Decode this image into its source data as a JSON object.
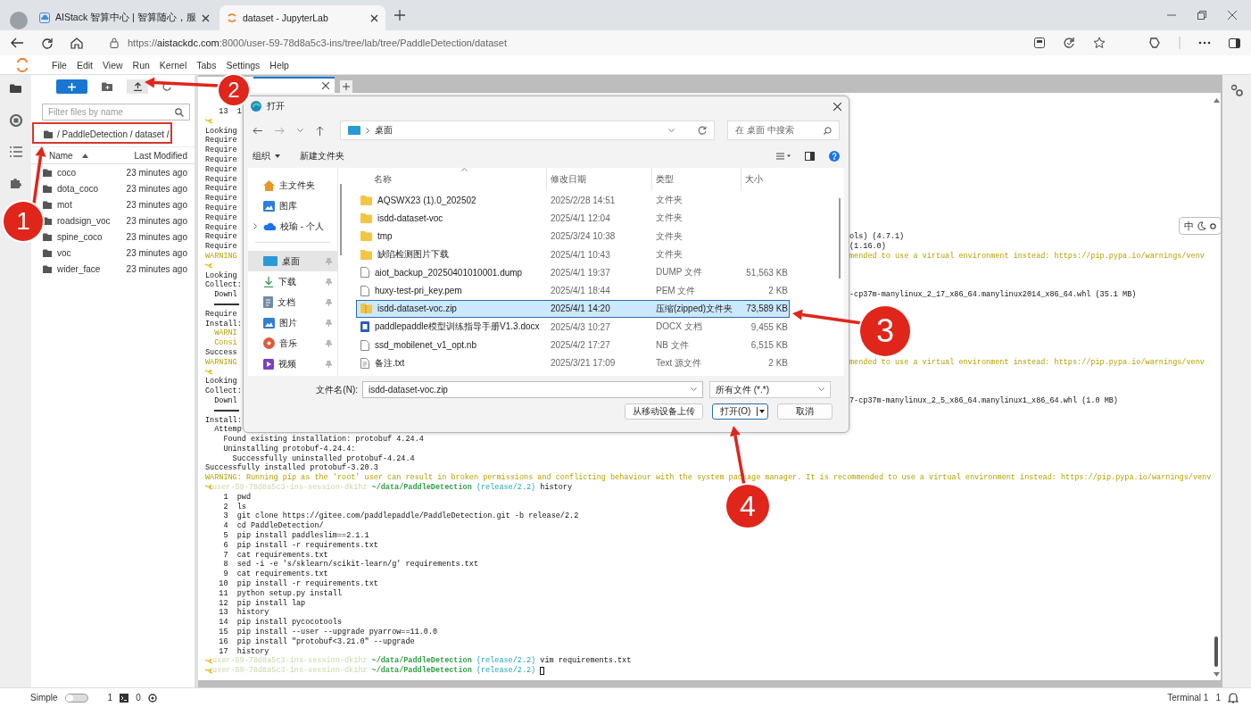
{
  "browser": {
    "tabs": [
      {
        "title": "AIStack 智算中心 | 智算随心，服",
        "selected": false
      },
      {
        "title": "dataset - JupyterLab",
        "selected": true
      }
    ],
    "url": "https://**aistackdc.com**:8000/user-59-78d8a5c3-ins/tree/lab/tree/PaddleDetection/dataset"
  },
  "menu": [
    "File",
    "Edit",
    "View",
    "Run",
    "Kernel",
    "Tabs",
    "Settings",
    "Help"
  ],
  "file_browser": {
    "filter_placeholder": "Filter files by name",
    "breadcrumb": "/ PaddleDetection / dataset /",
    "columns": [
      "Name",
      "Last Modified"
    ],
    "items": [
      {
        "name": "coco",
        "modified": "23 minutes ago"
      },
      {
        "name": "dota_coco",
        "modified": "23 minutes ago"
      },
      {
        "name": "mot",
        "modified": "23 minutes ago"
      },
      {
        "name": "roadsign_voc",
        "modified": "23 minutes ago"
      },
      {
        "name": "spine_coco",
        "modified": "23 minutes ago"
      },
      {
        "name": "voc",
        "modified": "23 minutes ago"
      },
      {
        "name": "wider_face",
        "modified": "23 minutes ago"
      }
    ]
  },
  "terminal": {
    "lines": [
      {
        "kind": "plain",
        "text": "   13  1"
      },
      {
        "kind": "mark"
      },
      {
        "kind": "plain",
        "text": "Looking"
      },
      {
        "kind": "plain",
        "text": "Require"
      },
      {
        "kind": "plain",
        "text": "Require"
      },
      {
        "kind": "plain",
        "text": "Require"
      },
      {
        "kind": "plain",
        "text": "Require"
      },
      {
        "kind": "plain",
        "text": "Require"
      },
      {
        "kind": "plain",
        "text": "Require"
      },
      {
        "kind": "plain",
        "text": "Require"
      },
      {
        "kind": "plain",
        "text": "Require"
      },
      {
        "kind": "plain",
        "text": "Require"
      },
      {
        "kind": "plain",
        "text": "Require"
      },
      {
        "kind": "plain",
        "text": "Require",
        "tail": "ols) (4.7.1)"
      },
      {
        "kind": "plain",
        "text": "Require",
        "tail": "(1.16.0)"
      },
      {
        "kind": "warning",
        "text": "WARNING",
        "tail": "mended to use a virtual environment instead: https://pip.pypa.io/warnings/venv"
      },
      {
        "kind": "mark"
      },
      {
        "kind": "plain",
        "text": "Looking"
      },
      {
        "kind": "plain",
        "text": "Collect:"
      },
      {
        "kind": "plain",
        "text": "  Downl",
        "tail": "-cp37m-manylinux_2_17_x86_64.manylinux2014_x86_64.whl (35.1 MB)"
      },
      {
        "kind": "bar",
        "level": 1
      },
      {
        "kind": "plain",
        "text": "Require"
      },
      {
        "kind": "plain",
        "text": "Install:"
      },
      {
        "kind": "warning",
        "text": "  WARNI"
      },
      {
        "kind": "warning",
        "text": "  Consi"
      },
      {
        "kind": "plain",
        "text": "Success"
      },
      {
        "kind": "warning",
        "text": "WARNING",
        "tail": "mended to use a virtual environment instead: https://pip.pypa.io/warnings/venv"
      },
      {
        "kind": "mark"
      },
      {
        "kind": "plain",
        "text": "Looking"
      },
      {
        "kind": "plain",
        "text": "Collect:"
      },
      {
        "kind": "plain",
        "text": "  Downl",
        "tail": "7-cp37m-manylinux_2_5_x86_64.manylinux1_x86_64.whl (1.0 MB)"
      },
      {
        "kind": "bar",
        "level": 1
      },
      {
        "kind": "plain",
        "text": "Install:"
      },
      {
        "kind": "plain",
        "text": "  Attemp"
      },
      {
        "kind": "plain",
        "text": "    Found existing installation: protobuf 4.24.4"
      },
      {
        "kind": "plain",
        "text": "    Uninstalling protobuf-4.24.4:"
      },
      {
        "kind": "plain",
        "text": "      Successfully uninstalled protobuf-4.24.4"
      },
      {
        "kind": "plain",
        "text": "Successfully installed protobuf-3.20.3"
      },
      {
        "kind": "warning",
        "text": "WARNING: Running pip as the 'root' user can result in broken permissions and conflicting behaviour with the system package manager. It is recommended to use a virtual environment instead: https://pip.pypa.io/warnings/venv"
      },
      {
        "kind": "prompt",
        "user": "user-59-78d8a5c3-ins-session-dk1hz",
        "path": "~/data/PaddleDetection",
        "branch": "(release/2.2)",
        "command": "history"
      },
      {
        "kind": "plain",
        "text": "    1  pwd"
      },
      {
        "kind": "plain",
        "text": "    2  ls"
      },
      {
        "kind": "plain",
        "text": "    3  git clone https://gitee.com/paddlepaddle/PaddleDetection.git -b release/2.2"
      },
      {
        "kind": "plain",
        "text": "    4  cd PaddleDetection/"
      },
      {
        "kind": "plain",
        "text": "    5  pip install paddleslim==2.1.1"
      },
      {
        "kind": "plain",
        "text": "    6  pip install -r requirements.txt"
      },
      {
        "kind": "plain",
        "text": "    7  cat requirements.txt"
      },
      {
        "kind": "plain",
        "text": "    8  sed -i -e 's/sklearn/scikit-learn/g' requirements.txt"
      },
      {
        "kind": "plain",
        "text": "    9  cat requirements.txt"
      },
      {
        "kind": "plain",
        "text": "   10  pip install -r requirements.txt"
      },
      {
        "kind": "plain",
        "text": "   11  python setup.py install"
      },
      {
        "kind": "plain",
        "text": "   12  pip install lap"
      },
      {
        "kind": "plain",
        "text": "   13  history"
      },
      {
        "kind": "plain",
        "text": "   14  pip install pycocotools"
      },
      {
        "kind": "plain",
        "text": "   15  pip install --user --upgrade pyarrow==11.0.0"
      },
      {
        "kind": "plain",
        "text": "   16  pip install \"protobuf<3.21.0\" --upgrade"
      },
      {
        "kind": "plain",
        "text": "   17  history"
      },
      {
        "kind": "prompt",
        "user": "user-59-78d8a5c3-ins-session-dk1hz",
        "path": "~/data/PaddleDetection",
        "branch": "(release/2.2)",
        "command": "vim requirements.txt"
      },
      {
        "kind": "prompt",
        "user": "user-59-78d8a5c3-ins-session-dk1hz",
        "path": "~/data/PaddleDetection",
        "branch": "(release/2.2)",
        "cursor": true
      }
    ]
  },
  "ime": {
    "label": "中"
  },
  "dialog": {
    "title": "打开",
    "location": "桌面",
    "search_placeholder": "在 桌面 中搜索",
    "organize": "组织",
    "new_folder": "新建文件夹",
    "nav": [
      {
        "label": "主文件夹",
        "kind": "home",
        "selected": false,
        "pinned": false,
        "expandable": false
      },
      {
        "label": "图库",
        "kind": "gallery",
        "selected": false,
        "pinned": false,
        "expandable": false
      },
      {
        "label": "校瑜 - 个人",
        "kind": "cloud",
        "selected": false,
        "pinned": false,
        "expandable": true
      },
      {
        "label": "桌面",
        "kind": "desktop",
        "selected": true,
        "pinned": true,
        "expandable": false
      },
      {
        "label": "下载",
        "kind": "download",
        "selected": false,
        "pinned": true,
        "expandable": false
      },
      {
        "label": "文档",
        "kind": "documents",
        "selected": false,
        "pinned": true,
        "expandable": false
      },
      {
        "label": "图片",
        "kind": "pictures",
        "selected": false,
        "pinned": true,
        "expandable": false
      },
      {
        "label": "音乐",
        "kind": "music",
        "selected": false,
        "pinned": true,
        "expandable": false
      },
      {
        "label": "视频",
        "kind": "videos",
        "selected": false,
        "pinned": true,
        "expandable": false
      }
    ],
    "columns": [
      "名称",
      "修改日期",
      "类型",
      "大小"
    ],
    "files": [
      {
        "name": "AQSWX23 (1).0_202502",
        "date": "2025/2/28 14:51",
        "type": "文件夹",
        "kind": "folder",
        "selected": false
      },
      {
        "name": "isdd-dataset-voc",
        "date": "2025/4/1 12:04",
        "type": "文件夹",
        "kind": "folder",
        "selected": false
      },
      {
        "name": "tmp",
        "date": "2025/3/24 10:38",
        "type": "文件夹",
        "kind": "folder",
        "selected": false
      },
      {
        "name": "缺陷检测图片下载",
        "date": "2025/4/1 10:43",
        "type": "文件夹",
        "kind": "folder",
        "selected": false
      },
      {
        "name": "aiot_backup_20250401010001.dump",
        "date": "2025/4/1 19:37",
        "type": "DUMP 文件",
        "size": "51,563 KB",
        "kind": "file",
        "selected": false
      },
      {
        "name": "huxy-test-pri_key.pem",
        "date": "2025/4/1 18:44",
        "type": "PEM 文件",
        "size": "2 KB",
        "kind": "file",
        "selected": false
      },
      {
        "name": "isdd-dataset-voc.zip",
        "date": "2025/4/1 14:20",
        "type": "压缩(zipped)文件夹",
        "size": "73,589 KB",
        "kind": "zip",
        "selected": true
      },
      {
        "name": "paddlepaddle模型训练指导手册V1.3.docx",
        "date": "2025/4/3 10:27",
        "type": "DOCX 文档",
        "size": "9,455 KB",
        "kind": "word",
        "selected": false
      },
      {
        "name": "ssd_mobilenet_v1_opt.nb",
        "date": "2025/4/2 17:27",
        "type": "NB 文件",
        "size": "6,515 KB",
        "kind": "file",
        "selected": false
      },
      {
        "name": "备注.txt",
        "date": "2025/3/21 17:09",
        "type": "Text 源文件",
        "size": "2 KB",
        "kind": "text",
        "selected": false
      }
    ],
    "filename_label": "文件名(N):",
    "filename": "isdd-dataset-voc.zip",
    "filter": "所有文件 (*.*)",
    "buttons": [
      "从移动设备上传",
      "打开(O)",
      "取消"
    ]
  },
  "status_bar": {
    "mode_label": "Simple",
    "simple_on": false,
    "terminals": "1",
    "kernels": "0",
    "right_label": "Terminal 1",
    "right_count": "1"
  },
  "annotations": [
    {
      "number": "1"
    },
    {
      "number": "2"
    },
    {
      "number": "3"
    },
    {
      "number": "4"
    }
  ]
}
